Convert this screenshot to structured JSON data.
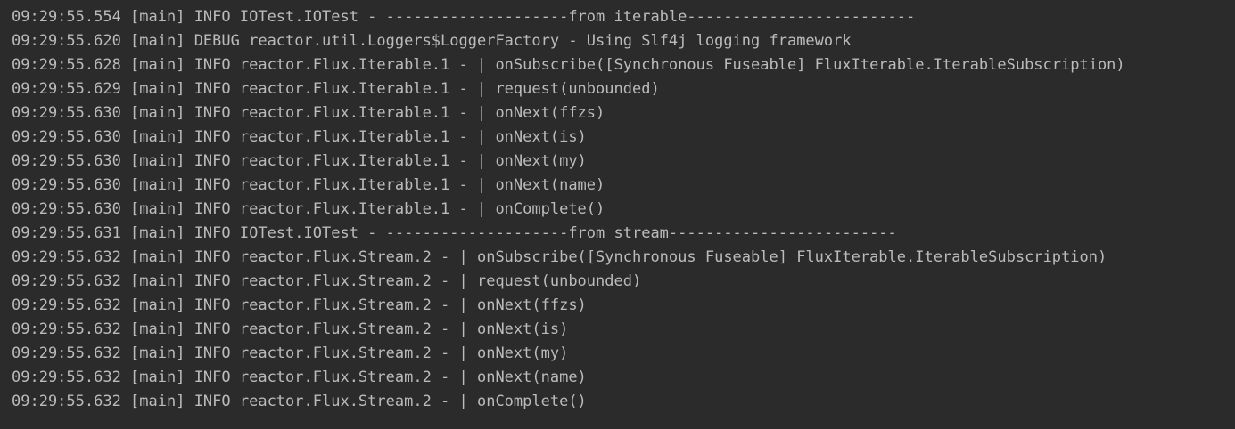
{
  "console": {
    "lines": [
      "09:29:55.554 [main] INFO IOTest.IOTest - --------------------from iterable-------------------------",
      "09:29:55.620 [main] DEBUG reactor.util.Loggers$LoggerFactory - Using Slf4j logging framework",
      "09:29:55.628 [main] INFO reactor.Flux.Iterable.1 - | onSubscribe([Synchronous Fuseable] FluxIterable.IterableSubscription)",
      "09:29:55.629 [main] INFO reactor.Flux.Iterable.1 - | request(unbounded)",
      "09:29:55.630 [main] INFO reactor.Flux.Iterable.1 - | onNext(ffzs)",
      "09:29:55.630 [main] INFO reactor.Flux.Iterable.1 - | onNext(is)",
      "09:29:55.630 [main] INFO reactor.Flux.Iterable.1 - | onNext(my)",
      "09:29:55.630 [main] INFO reactor.Flux.Iterable.1 - | onNext(name)",
      "09:29:55.630 [main] INFO reactor.Flux.Iterable.1 - | onComplete()",
      "09:29:55.631 [main] INFO IOTest.IOTest - --------------------from stream-------------------------",
      "09:29:55.632 [main] INFO reactor.Flux.Stream.2 - | onSubscribe([Synchronous Fuseable] FluxIterable.IterableSubscription)",
      "09:29:55.632 [main] INFO reactor.Flux.Stream.2 - | request(unbounded)",
      "09:29:55.632 [main] INFO reactor.Flux.Stream.2 - | onNext(ffzs)",
      "09:29:55.632 [main] INFO reactor.Flux.Stream.2 - | onNext(is)",
      "09:29:55.632 [main] INFO reactor.Flux.Stream.2 - | onNext(my)",
      "09:29:55.632 [main] INFO reactor.Flux.Stream.2 - | onNext(name)",
      "09:29:55.632 [main] INFO reactor.Flux.Stream.2 - | onComplete()"
    ],
    "colors": {
      "background": "#2b2b2b",
      "text": "#bbbbbb"
    }
  }
}
